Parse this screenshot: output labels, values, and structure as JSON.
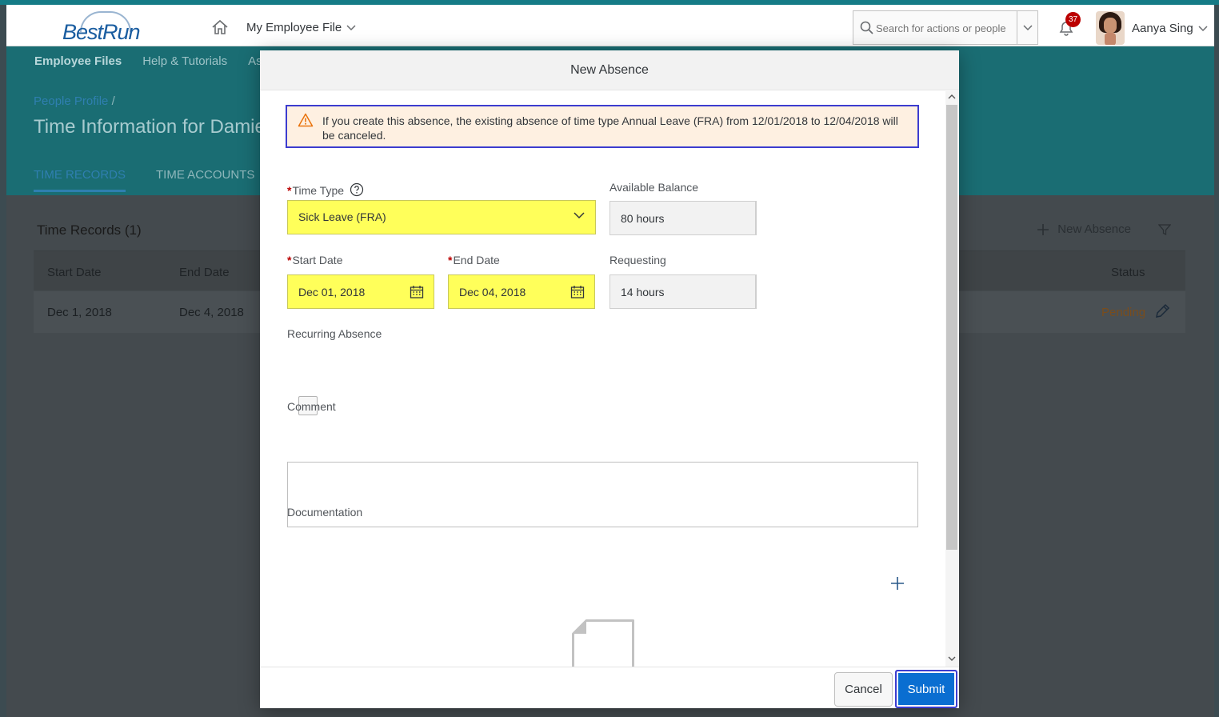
{
  "shell": {
    "logo_text": "BestRun",
    "module": "My Employee File",
    "search_placeholder": "Search for actions or people",
    "notification_count": "37",
    "user_name": "Aanya Sing"
  },
  "subnav": {
    "items": [
      "Employee Files",
      "Help & Tutorials",
      "As"
    ]
  },
  "page": {
    "breadcrumb_link": "People Profile",
    "breadcrumb_sep": "/",
    "title": "Time Information for Damie",
    "tabs": [
      "TIME RECORDS",
      "TIME ACCOUNTS"
    ]
  },
  "records": {
    "title": "Time Records (1)",
    "new_absence": "New Absence",
    "columns": [
      "Start Date",
      "End Date",
      "Status"
    ],
    "rows": [
      {
        "start": "Dec 1, 2018",
        "end": "Dec 4, 2018",
        "status": "Pending"
      }
    ]
  },
  "dialog": {
    "title": "New Absence",
    "warning": "If you create this absence, the existing absence of time type Annual Leave (FRA) from 12/01/2018 to 12/04/2018 will be canceled.",
    "required_mark": "*",
    "time_type_label": "Time Type",
    "time_type_value": "Sick Leave (FRA)",
    "available_balance_label": "Available Balance",
    "available_balance_value": "80 hours",
    "start_date_label": "Start Date",
    "start_date_value": "Dec 01, 2018",
    "end_date_label": "End Date",
    "end_date_value": "Dec 04, 2018",
    "requesting_label": "Requesting",
    "requesting_value": "14 hours",
    "recurring_label": "Recurring Absence",
    "comment_label": "Comment",
    "comment_value": "",
    "documentation_label": "Documentation",
    "cancel_label": "Cancel",
    "submit_label": "Submit"
  },
  "colors": {
    "highlight_yellow": "#ffff5a",
    "warning_bg": "#fef0e1",
    "brand_blue": "#0a6ed1",
    "pending_orange": "#e9730c",
    "focus_outline": "#3c3ccf"
  }
}
